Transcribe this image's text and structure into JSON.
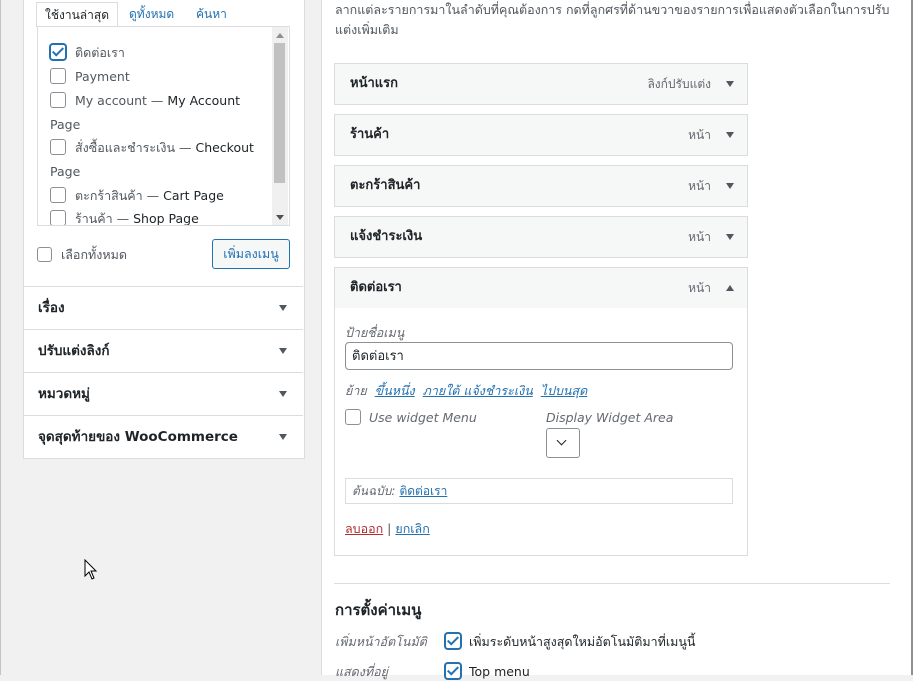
{
  "left_panel": {
    "tabs": [
      "ใช้งานล่าสุด",
      "ดูทั้งหมด",
      "ค้นหา"
    ],
    "items": [
      {
        "label": "ติดต่อเรา",
        "suffix": "",
        "checked": true
      },
      {
        "label": "Payment",
        "suffix": "",
        "checked": false
      },
      {
        "label": "My account —",
        "suffix": "My Account",
        "checked": false
      },
      {
        "label": "Page",
        "suffix": "",
        "checked": null
      },
      {
        "label": "สั่งซื้อและชำระเงิน —",
        "suffix": "Checkout",
        "checked": false
      },
      {
        "label": "Page",
        "suffix": "",
        "checked": null
      },
      {
        "label": "ตะกร้าสินค้า —",
        "suffix": "Cart Page",
        "checked": false
      },
      {
        "label": "ร้านค้า —",
        "suffix": "Shop Page",
        "checked": false
      }
    ],
    "select_all": "เลือกทั้งหมด",
    "add_button": "เพิ่มลงเมนู",
    "sections": [
      "เรื่อง",
      "ปรับแต่งลิงก์",
      "หมวดหมู่",
      "จุดสุดท้ายของ WooCommerce"
    ]
  },
  "right_panel": {
    "intro": "ลากแต่ละรายการมาในลำดับที่คุณต้องการ กดที่ลูกศรที่ด้านขวาของรายการเพื่อแสดงตัวเลือกในการปรับ แต่งเพิ่มเติม",
    "menu_items": [
      {
        "title": "หน้าแรก",
        "type": "ลิงก์ปรับแต่ง"
      },
      {
        "title": "ร้านค้า",
        "type": "หน้า"
      },
      {
        "title": "ตะกร้าสินค้า",
        "type": "หน้า"
      },
      {
        "title": "แจ้งชำระเงิน",
        "type": "หน้า"
      },
      {
        "title": "ติดต่อเรา",
        "type": "หน้า"
      }
    ],
    "expanded": {
      "nav_label": "ป้ายชื่อเมนู",
      "nav_value": "ติดต่อเรา",
      "move_label": "ย้าย",
      "move_links": [
        "ขึ้นหนึ่ง",
        "ภายใต้ แจ้งชำระเงิน",
        "ไปบนสุด"
      ],
      "use_widget_label": "Use widget Menu",
      "display_widget_label": "Display Widget Area",
      "original_label": "ต้นฉบับ:",
      "original_link": "ติดต่อเรา",
      "remove": "ลบออก",
      "separator": "|",
      "cancel": "ยกเลิก"
    },
    "settings": {
      "title": "การตั้งค่าเมนู",
      "auto_add_label": "เพิ่มหน้าอัตโนมัติ",
      "auto_add_value": "เพิ่มระดับหน้าสูงสุดใหม่อัตโนมัติมาที่เมนูนี้",
      "display_location_label": "แสดงที่อยู่",
      "display_location_value": "Top menu"
    }
  }
}
